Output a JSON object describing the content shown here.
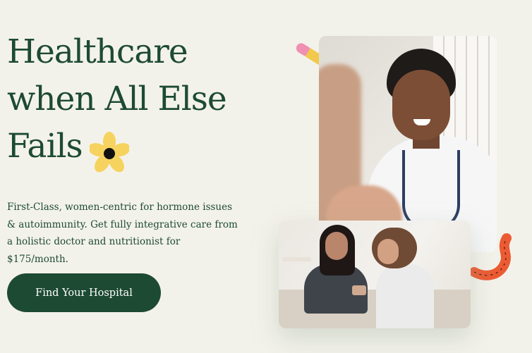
{
  "hero": {
    "title_lines": [
      "Healthcare",
      "when All Else",
      "Fails"
    ],
    "subtitle": "First-Class, women-centric for hormone issues & autoimmunity. Get fully integrative care from a holistic doctor and nutritionist for $175/month.",
    "cta_label": "Find Your Hospital"
  },
  "colors": {
    "brand_green": "#1d4a33",
    "background": "#f3f2ea",
    "flower_yellow": "#f6d35e",
    "accent_pink": "#ef8fb1",
    "accent_orange": "#ec5b33"
  },
  "decorations": [
    "flower-icon",
    "pencil-icon",
    "squiggle-icon"
  ],
  "images": [
    "doctor-photo",
    "consultation-photo"
  ]
}
